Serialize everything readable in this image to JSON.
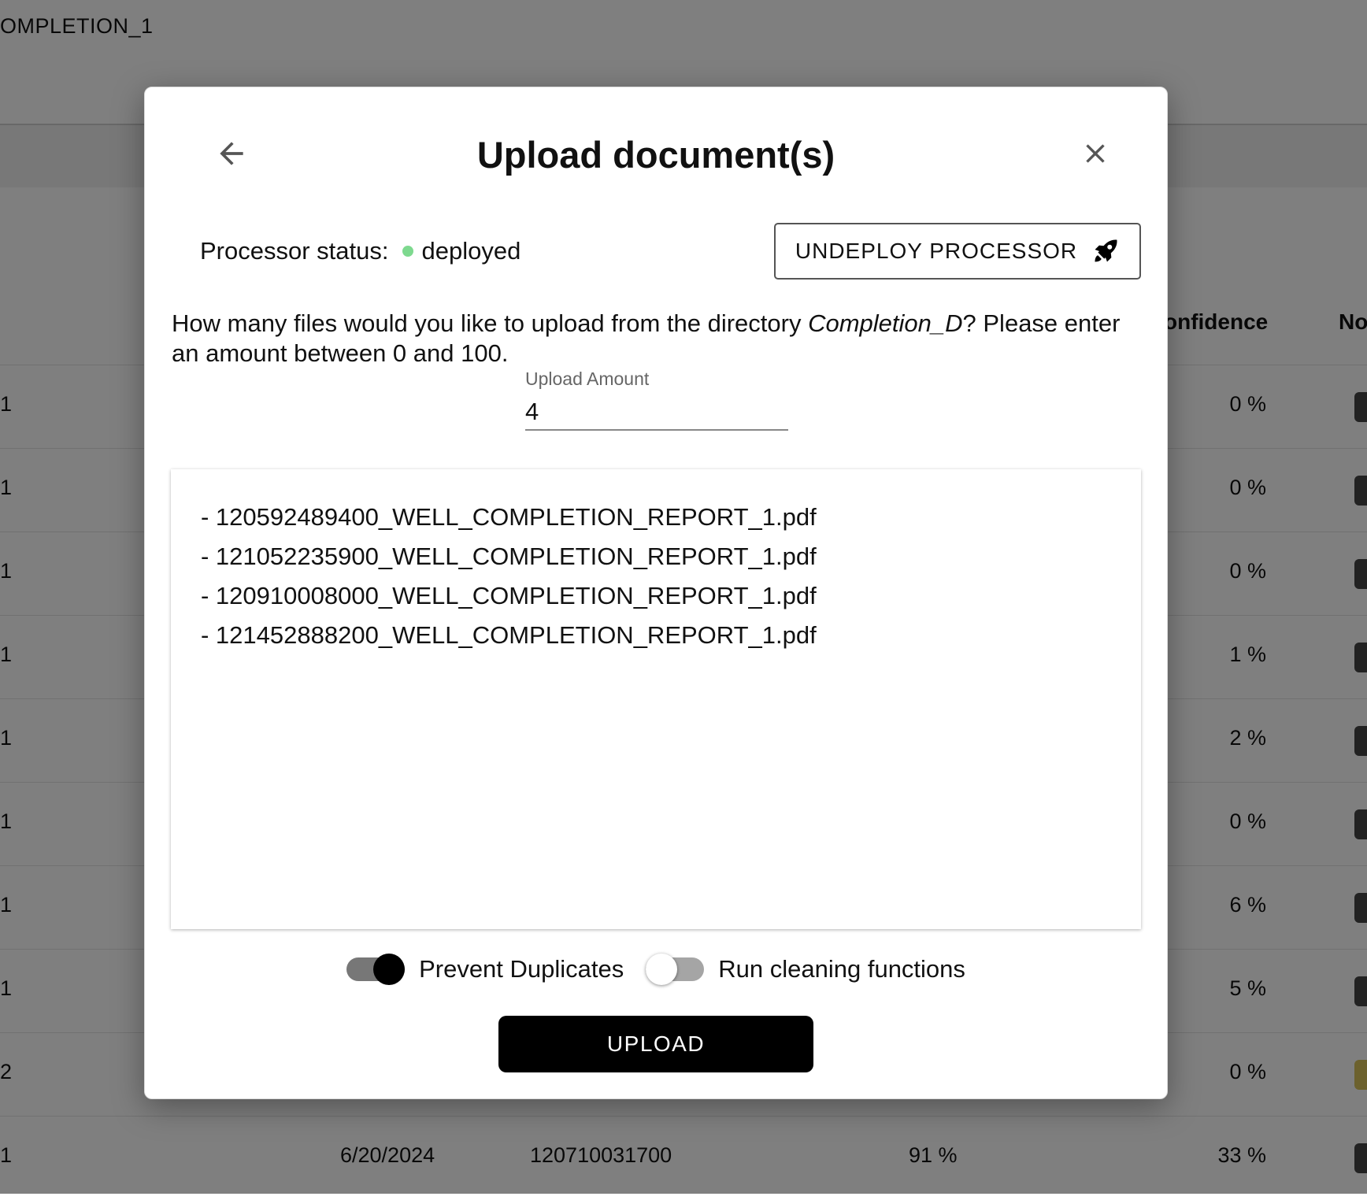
{
  "background": {
    "title": "OMPLETION_1",
    "column_headers": [
      "onfidence",
      "No"
    ],
    "rows": [
      {
        "c0": "1",
        "pct": "0 %",
        "btn_color": "dark"
      },
      {
        "c0": "1",
        "pct": "0 %",
        "btn_color": "dark"
      },
      {
        "c0": "1",
        "pct": "0 %",
        "btn_color": "dark"
      },
      {
        "c0": "1",
        "pct": "1 %",
        "btn_color": "dark"
      },
      {
        "c0": "1",
        "pct": "2 %",
        "btn_color": "dark"
      },
      {
        "c0": "1",
        "pct": "0 %",
        "btn_color": "dark"
      },
      {
        "c0": "1",
        "pct": "6 %",
        "btn_color": "dark"
      },
      {
        "c0": "1",
        "pct": "5 %",
        "btn_color": "dark"
      },
      {
        "c0": "2",
        "pct": "0 %",
        "btn_color": "yellow"
      },
      {
        "c0": "1",
        "date": "6/20/2024",
        "id": "120710031700",
        "acc": "91 %",
        "pct": "33 %",
        "btn_color": "dark"
      }
    ]
  },
  "modal": {
    "title": "Upload document(s)",
    "back_icon": "arrow-left-icon",
    "close_icon": "close-icon",
    "status_label": "Processor status:",
    "status_value": "deployed",
    "status_color": "#7ed98f",
    "undeploy_label": "UNDEPLOY PROCESSOR",
    "undeploy_icon": "rocket-icon",
    "prompt_before": "How many files would you like to upload from the directory ",
    "prompt_dir": "Completion_D",
    "prompt_after": "? Please enter an amount between 0 and 100.",
    "amount_label": "Upload Amount",
    "amount_value": "4",
    "files": [
      "- 120592489400_WELL_COMPLETION_REPORT_1.pdf",
      "- 121052235900_WELL_COMPLETION_REPORT_1.pdf",
      "- 120910008000_WELL_COMPLETION_REPORT_1.pdf",
      "- 121452888200_WELL_COMPLETION_REPORT_1.pdf"
    ],
    "toggles": [
      {
        "label": "Prevent Duplicates",
        "on": true
      },
      {
        "label": "Run cleaning functions",
        "on": false
      }
    ],
    "upload_label": "UPLOAD"
  }
}
